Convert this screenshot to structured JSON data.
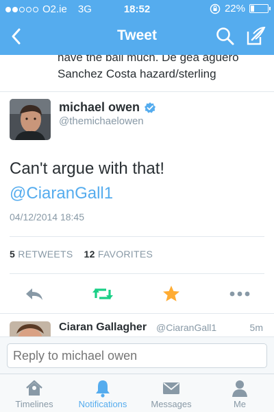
{
  "status_bar": {
    "carrier": "O2.ie",
    "network": "3G",
    "time": "18:52",
    "battery": "22%",
    "battery_level": 0.22,
    "signal_bars_filled": 2,
    "signal_bars_total": 5
  },
  "nav": {
    "title": "Tweet",
    "icons": [
      "back-chevron-icon",
      "search-icon",
      "compose-icon"
    ]
  },
  "previous_tweet": {
    "text_line1": "have the ball much. De gea aguero",
    "text_line2": "Sanchez Costa hazard/sterling"
  },
  "tweet": {
    "author_name": "michael owen",
    "author_handle": "@themichaelowen",
    "verified": true,
    "text": "Can't argue with that!",
    "mention": "@CiaranGall1",
    "timestamp": "04/12/2014 18:45"
  },
  "stats": {
    "retweets_count": "5",
    "retweets_label": "RETWEETS",
    "favorites_count": "12",
    "favorites_label": "FAVORITES"
  },
  "actions": [
    "reply-icon",
    "retweet-icon",
    "favorite-star-icon",
    "more-icon"
  ],
  "reply_preview": {
    "name": "Ciaran Gallagher",
    "handle": "@CiaranGall1",
    "time": "5m"
  },
  "composer": {
    "placeholder": "Reply to michael owen"
  },
  "tabs": [
    {
      "label": "Timelines",
      "icon": "home-icon",
      "active": false
    },
    {
      "label": "Notifications",
      "icon": "bell-icon",
      "active": true
    },
    {
      "label": "Messages",
      "icon": "envelope-icon",
      "active": false
    },
    {
      "label": "Me",
      "icon": "person-icon",
      "active": false
    }
  ],
  "colors": {
    "brand_blue": "#55acee",
    "retweet_green": "#19cf86",
    "favorite_gold": "#ffac33",
    "muted_gray": "#8899a6"
  }
}
